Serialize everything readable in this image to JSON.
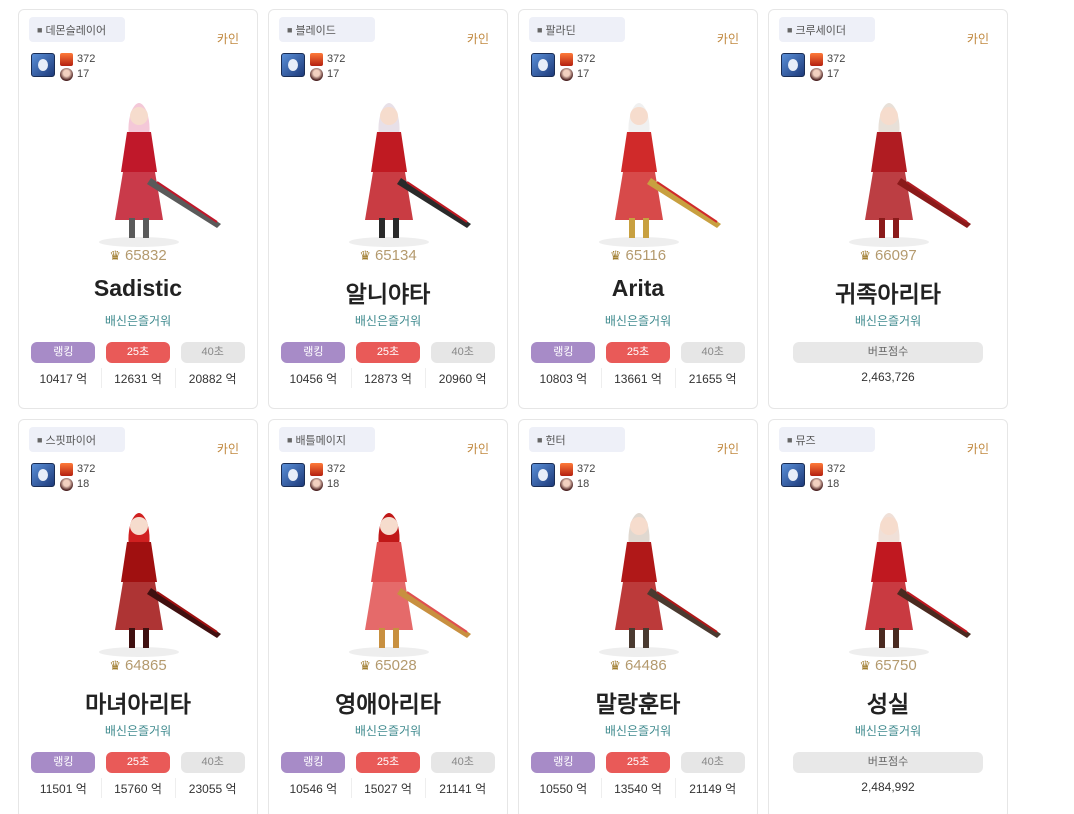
{
  "cards": [
    {
      "job": "데몬슬레이어",
      "server": "카인",
      "level_a": "372",
      "level_b": "17",
      "fame": "65832",
      "name": "Sadistic",
      "guild": "배신은즐거워",
      "mode": "stats",
      "rank_label": "랭킹",
      "s25_label": "25초",
      "s40_label": "40초",
      "rank_val": "10417 억",
      "s25_val": "12631 억",
      "s40_val": "20882 억"
    },
    {
      "job": "블레이드",
      "server": "카인",
      "level_a": "372",
      "level_b": "17",
      "fame": "65134",
      "name": "알니야타",
      "guild": "배신은즐거워",
      "mode": "stats",
      "rank_label": "랭킹",
      "s25_label": "25초",
      "s40_label": "40초",
      "rank_val": "10456 억",
      "s25_val": "12873 억",
      "s40_val": "20960 억"
    },
    {
      "job": "팔라딘",
      "server": "카인",
      "level_a": "372",
      "level_b": "17",
      "fame": "65116",
      "name": "Arita",
      "guild": "배신은즐거워",
      "mode": "stats",
      "rank_label": "랭킹",
      "s25_label": "25초",
      "s40_label": "40초",
      "rank_val": "10803 억",
      "s25_val": "13661 억",
      "s40_val": "21655 억"
    },
    {
      "job": "크루세이더",
      "server": "카인",
      "level_a": "372",
      "level_b": "17",
      "fame": "66097",
      "name": "귀족아리타",
      "guild": "배신은즐거워",
      "mode": "buff",
      "buff_label": "버프점수",
      "buff_val": "2,463,726"
    },
    {
      "job": "스핏파이어",
      "server": "카인",
      "level_a": "372",
      "level_b": "18",
      "fame": "64865",
      "name": "마녀아리타",
      "guild": "배신은즐거워",
      "mode": "stats",
      "rank_label": "랭킹",
      "s25_label": "25초",
      "s40_label": "40초",
      "rank_val": "11501 억",
      "s25_val": "15760 억",
      "s40_val": "23055 억"
    },
    {
      "job": "배틀메이지",
      "server": "카인",
      "level_a": "372",
      "level_b": "18",
      "fame": "65028",
      "name": "영애아리타",
      "guild": "배신은즐거워",
      "mode": "stats",
      "rank_label": "랭킹",
      "s25_label": "25초",
      "s40_label": "40초",
      "rank_val": "10546 억",
      "s25_val": "15027 억",
      "s40_val": "21141 억"
    },
    {
      "job": "헌터",
      "server": "카인",
      "level_a": "372",
      "level_b": "18",
      "fame": "64486",
      "name": "말랑훈타",
      "guild": "배신은즐거워",
      "mode": "stats",
      "rank_label": "랭킹",
      "s25_label": "25초",
      "s40_label": "40초",
      "rank_val": "10550 억",
      "s25_val": "13540 억",
      "s40_val": "21149 억"
    },
    {
      "job": "뮤즈",
      "server": "카인",
      "level_a": "372",
      "level_b": "18",
      "fame": "65750",
      "name": "성실",
      "guild": "배신은즐거워",
      "mode": "buff",
      "buff_label": "버프점수",
      "buff_val": "2,484,992"
    }
  ],
  "colors": {
    "rank": "#a78bc7",
    "s25": "#e95a58",
    "s40": "#e6e6e6",
    "guild": "#3f8a8e",
    "server": "#c0883e"
  }
}
